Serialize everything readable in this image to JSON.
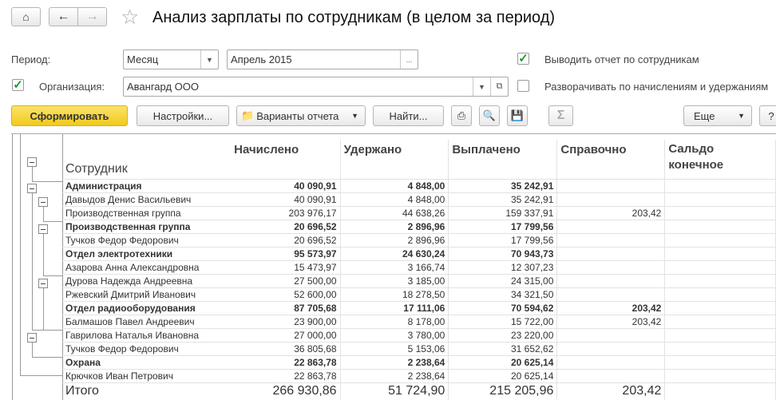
{
  "header": {
    "title": "Анализ зарплаты по сотрудникам (в целом за период)",
    "home_icon": "home-icon",
    "back_icon": "arrow-left-icon",
    "forward_icon": "arrow-right-icon",
    "favorite_icon": "star-icon"
  },
  "filters": {
    "period_label": "Период:",
    "period_type": "Месяц",
    "period_value": "Апрель 2015",
    "period_select_button": "...",
    "org_checked": true,
    "org_label": "Организация:",
    "org_value": "Авангард ООО",
    "by_employees_checked": true,
    "by_employees_label": "Выводить отчет по сотрудникам",
    "expand_checked": false,
    "expand_label": "Разворачивать по начислениям и удержаниям"
  },
  "toolbar": {
    "generate": "Сформировать",
    "settings": "Настройки...",
    "variants": "Варианты отчета",
    "find": "Найти...",
    "more": "Еще",
    "help": "?",
    "sum_icon": "Σ"
  },
  "colors": {
    "primary_button": "#f5d230",
    "check": "#1c9b2f"
  },
  "report": {
    "columns": [
      "Сотрудник",
      "Начислено",
      "Удержано",
      "Выплачено",
      "Справочно",
      "Сальдо конечное"
    ],
    "rows": [
      {
        "bold": true,
        "cells": [
          "Администрация",
          "40 090,91",
          "4 848,00",
          "35 242,91",
          "",
          ""
        ]
      },
      {
        "bold": false,
        "cells": [
          "Давыдов Денис Васильевич",
          "40 090,91",
          "4 848,00",
          "35 242,91",
          "",
          ""
        ]
      },
      {
        "bold": false,
        "cells": [
          "Производственная группа",
          "203 976,17",
          "44 638,26",
          "159 337,91",
          "203,42",
          ""
        ]
      },
      {
        "bold": true,
        "cells": [
          "Производственная группа",
          "20 696,52",
          "2 896,96",
          "17 799,56",
          "",
          ""
        ]
      },
      {
        "bold": false,
        "cells": [
          "Тучков Федор Федорович",
          "20 696,52",
          "2 896,96",
          "17 799,56",
          "",
          ""
        ]
      },
      {
        "bold": true,
        "cells": [
          "Отдел электротехники",
          "95 573,97",
          "24 630,24",
          "70 943,73",
          "",
          ""
        ]
      },
      {
        "bold": false,
        "cells": [
          "Азарова Анна Александровна",
          "15 473,97",
          "3 166,74",
          "12 307,23",
          "",
          ""
        ]
      },
      {
        "bold": false,
        "cells": [
          "Дурова Надежда Андреевна",
          "27 500,00",
          "3 185,00",
          "24 315,00",
          "",
          ""
        ]
      },
      {
        "bold": false,
        "cells": [
          "Ржевский Дмитрий Иванович",
          "52 600,00",
          "18 278,50",
          "34 321,50",
          "",
          ""
        ]
      },
      {
        "bold": true,
        "cells": [
          "Отдел радиооборудования",
          "87 705,68",
          "17 111,06",
          "70 594,62",
          "203,42",
          ""
        ]
      },
      {
        "bold": false,
        "cells": [
          "Балмашов Павел Андреевич",
          "23 900,00",
          "8 178,00",
          "15 722,00",
          "203,42",
          ""
        ]
      },
      {
        "bold": false,
        "cells": [
          "Гаврилова Наталья Ивановна",
          "27 000,00",
          "3 780,00",
          "23 220,00",
          "",
          ""
        ]
      },
      {
        "bold": false,
        "cells": [
          "Тучков Федор Федорович",
          "36 805,68",
          "5 153,06",
          "31 652,62",
          "",
          ""
        ]
      },
      {
        "bold": true,
        "cells": [
          "Охрана",
          "22 863,78",
          "2 238,64",
          "20 625,14",
          "",
          ""
        ]
      },
      {
        "bold": false,
        "cells": [
          "Крючков Иван Петрович",
          "22 863,78",
          "2 238,64",
          "20 625,14",
          "",
          ""
        ]
      }
    ],
    "total": [
      "Итого",
      "266 930,86",
      "51 724,90",
      "215 205,96",
      "203,42",
      ""
    ]
  }
}
